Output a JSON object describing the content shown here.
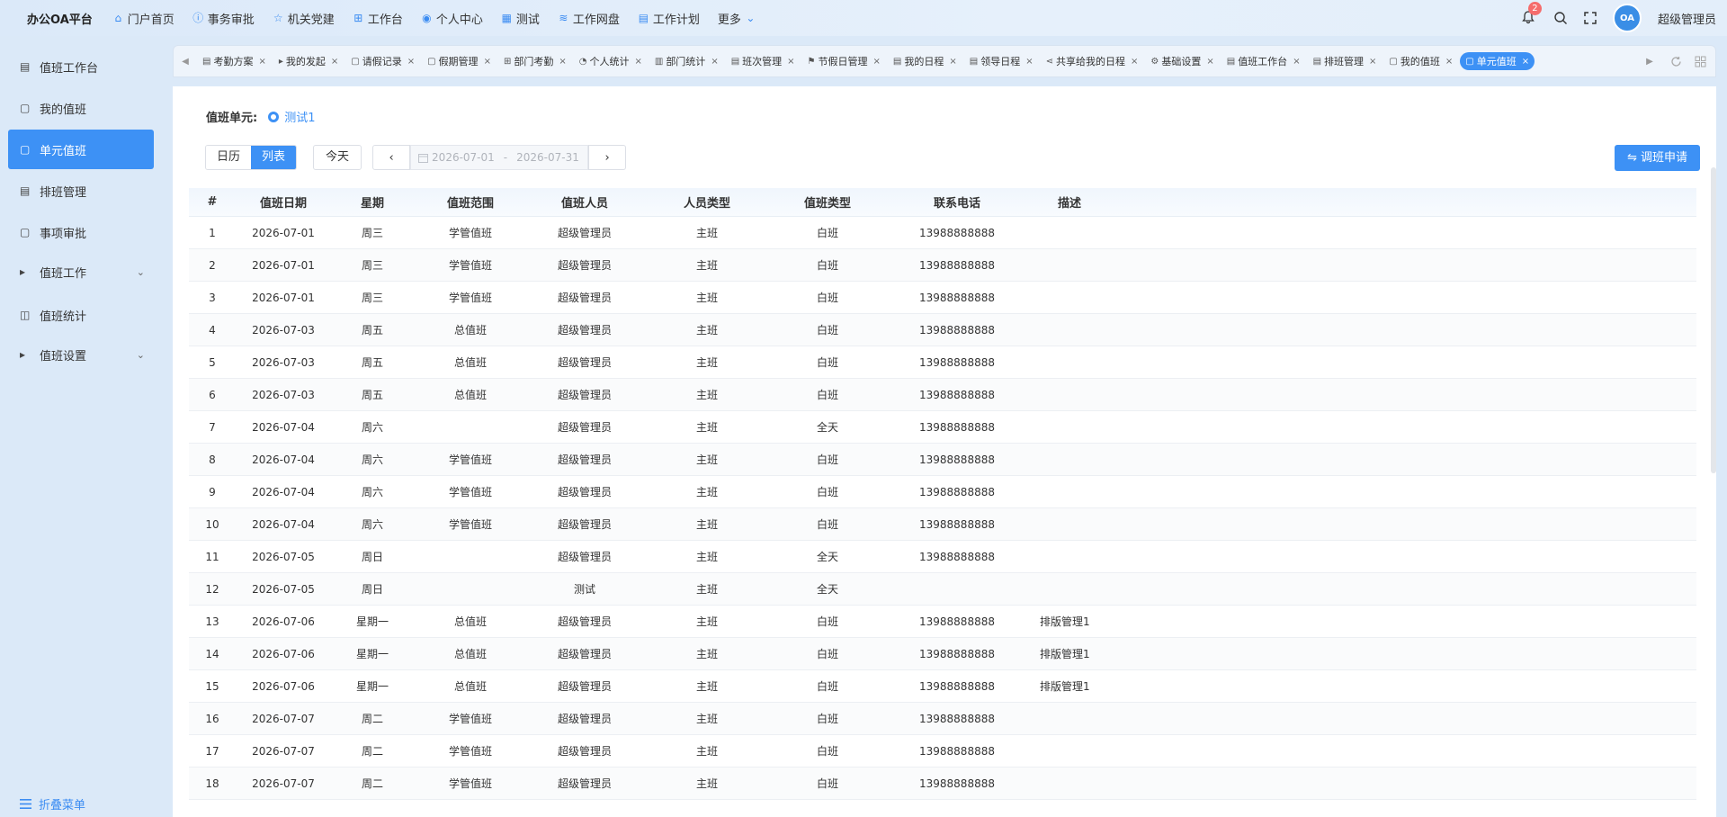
{
  "topnav": {
    "brand": "办公OA平台",
    "items": [
      {
        "label": "门户首页",
        "icon": "home-icon"
      },
      {
        "label": "事务审批",
        "icon": "info-icon"
      },
      {
        "label": "机关党建",
        "icon": "star-icon"
      },
      {
        "label": "工作台",
        "icon": "sitemap-icon"
      },
      {
        "label": "个人中心",
        "icon": "user-icon"
      },
      {
        "label": "测试",
        "icon": "grid-icon"
      },
      {
        "label": "工作网盘",
        "icon": "database-icon"
      },
      {
        "label": "工作计划",
        "icon": "calendar-icon"
      },
      {
        "label": "更多",
        "icon": "chevron-down-icon"
      }
    ],
    "notification_count": "2",
    "avatar_text": "OA",
    "username": "超级管理员"
  },
  "sidebar": {
    "items": [
      {
        "label": "值班工作台",
        "icon": "calendar-icon",
        "active": false
      },
      {
        "label": "我的值班",
        "icon": "document-icon",
        "active": false
      },
      {
        "label": "单元值班",
        "icon": "document-icon",
        "active": true
      },
      {
        "label": "排班管理",
        "icon": "calendar-icon",
        "active": false
      },
      {
        "label": "事项审批",
        "icon": "document-icon",
        "active": false
      },
      {
        "label": "值班工作",
        "icon": "caret-right-icon",
        "active": false,
        "expandable": true
      },
      {
        "label": "值班统计",
        "icon": "chart-board-icon",
        "active": false
      },
      {
        "label": "值班设置",
        "icon": "caret-right-icon",
        "active": false,
        "expandable": true
      }
    ],
    "collapse_label": "折叠菜单"
  },
  "tabs": [
    {
      "label": "考勤方案",
      "icon": "calendar-icon"
    },
    {
      "label": "我的发起",
      "icon": "play-icon"
    },
    {
      "label": "请假记录",
      "icon": "document-icon"
    },
    {
      "label": "假期管理",
      "icon": "document-icon"
    },
    {
      "label": "部门考勤",
      "icon": "sitemap-icon"
    },
    {
      "label": "个人统计",
      "icon": "pie-icon"
    },
    {
      "label": "部门统计",
      "icon": "bar-chart-icon"
    },
    {
      "label": "班次管理",
      "icon": "calendar-icon"
    },
    {
      "label": "节假日管理",
      "icon": "flag-icon"
    },
    {
      "label": "我的日程",
      "icon": "calendar-icon"
    },
    {
      "label": "领导日程",
      "icon": "calendar-icon"
    },
    {
      "label": "共享给我的日程",
      "icon": "share-icon"
    },
    {
      "label": "基础设置",
      "icon": "gear-icon"
    },
    {
      "label": "值班工作台",
      "icon": "calendar-icon"
    },
    {
      "label": "排班管理",
      "icon": "calendar-icon"
    },
    {
      "label": "我的值班",
      "icon": "document-icon"
    },
    {
      "label": "单元值班",
      "icon": "document-icon",
      "active": true
    }
  ],
  "unit": {
    "label": "值班单元:",
    "value": "测试1"
  },
  "toolbar": {
    "view_calendar": "日历",
    "view_list": "列表",
    "today": "今天",
    "date_start": "2026-07-01",
    "date_sep": "-",
    "date_end": "2026-07-31",
    "swap_request": "调班申请"
  },
  "table": {
    "columns": [
      "#",
      "值班日期",
      "星期",
      "值班范围",
      "值班人员",
      "人员类型",
      "值班类型",
      "联系电话",
      "描述"
    ],
    "rows": [
      [
        "1",
        "2026-07-01",
        "周三",
        "学管值班",
        "超级管理员",
        "主班",
        "白班",
        "13988888888",
        ""
      ],
      [
        "2",
        "2026-07-01",
        "周三",
        "学管值班",
        "超级管理员",
        "主班",
        "白班",
        "13988888888",
        ""
      ],
      [
        "3",
        "2026-07-01",
        "周三",
        "学管值班",
        "超级管理员",
        "主班",
        "白班",
        "13988888888",
        ""
      ],
      [
        "4",
        "2026-07-03",
        "周五",
        "总值班",
        "超级管理员",
        "主班",
        "白班",
        "13988888888",
        ""
      ],
      [
        "5",
        "2026-07-03",
        "周五",
        "总值班",
        "超级管理员",
        "主班",
        "白班",
        "13988888888",
        ""
      ],
      [
        "6",
        "2026-07-03",
        "周五",
        "总值班",
        "超级管理员",
        "主班",
        "白班",
        "13988888888",
        ""
      ],
      [
        "7",
        "2026-07-04",
        "周六",
        "",
        "超级管理员",
        "主班",
        "全天",
        "13988888888",
        ""
      ],
      [
        "8",
        "2026-07-04",
        "周六",
        "学管值班",
        "超级管理员",
        "主班",
        "白班",
        "13988888888",
        ""
      ],
      [
        "9",
        "2026-07-04",
        "周六",
        "学管值班",
        "超级管理员",
        "主班",
        "白班",
        "13988888888",
        ""
      ],
      [
        "10",
        "2026-07-04",
        "周六",
        "学管值班",
        "超级管理员",
        "主班",
        "白班",
        "13988888888",
        ""
      ],
      [
        "11",
        "2026-07-05",
        "周日",
        "",
        "超级管理员",
        "主班",
        "全天",
        "13988888888",
        ""
      ],
      [
        "12",
        "2026-07-05",
        "周日",
        "",
        "测试",
        "主班",
        "全天",
        "",
        ""
      ],
      [
        "13",
        "2026-07-06",
        "星期一",
        "总值班",
        "超级管理员",
        "主班",
        "白班",
        "13988888888",
        "排版管理1"
      ],
      [
        "14",
        "2026-07-06",
        "星期一",
        "总值班",
        "超级管理员",
        "主班",
        "白班",
        "13988888888",
        "排版管理1"
      ],
      [
        "15",
        "2026-07-06",
        "星期一",
        "总值班",
        "超级管理员",
        "主班",
        "白班",
        "13988888888",
        "排版管理1"
      ],
      [
        "16",
        "2026-07-07",
        "周二",
        "学管值班",
        "超级管理员",
        "主班",
        "白班",
        "13988888888",
        ""
      ],
      [
        "17",
        "2026-07-07",
        "周二",
        "学管值班",
        "超级管理员",
        "主班",
        "白班",
        "13988888888",
        ""
      ],
      [
        "18",
        "2026-07-07",
        "周二",
        "学管值班",
        "超级管理员",
        "主班",
        "白班",
        "13988888888",
        ""
      ]
    ]
  },
  "colors": {
    "accent": "#3d91f5",
    "badge": "#f56c6c"
  }
}
